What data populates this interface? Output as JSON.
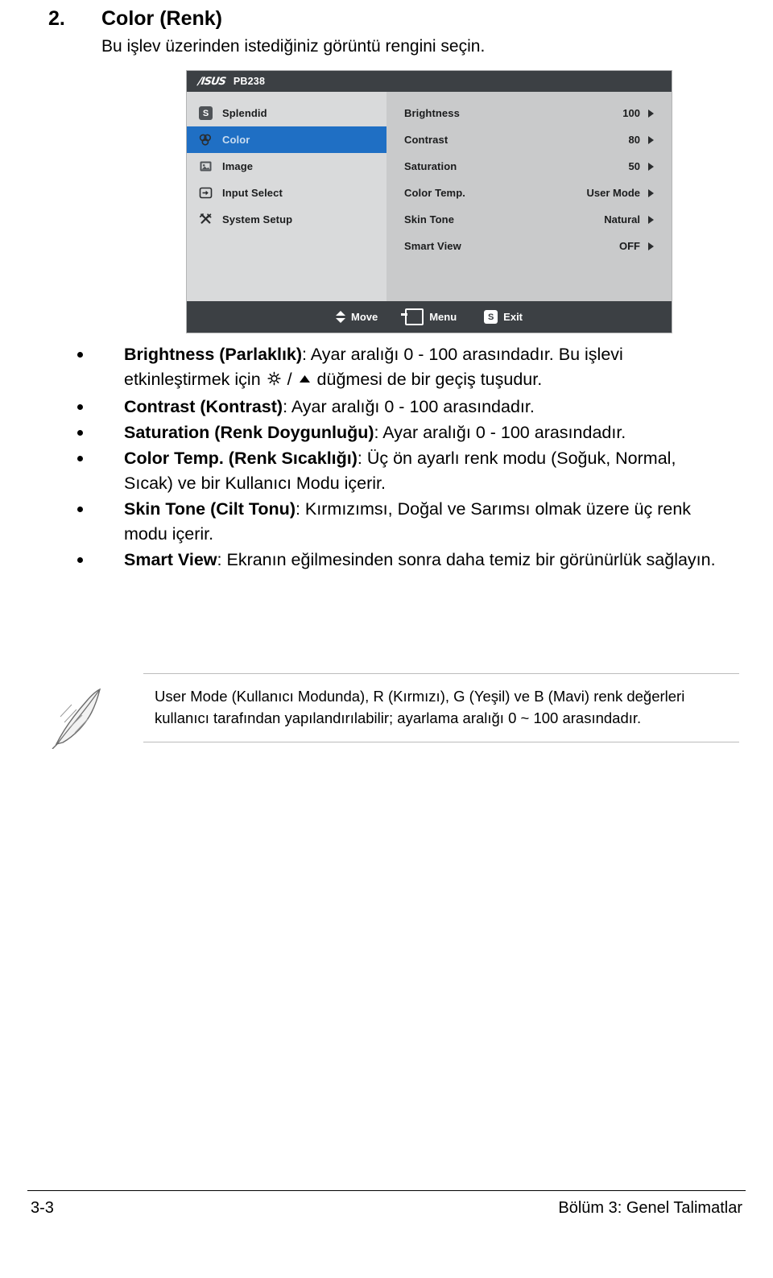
{
  "heading": {
    "number": "2.",
    "title": "Color (Renk)",
    "subtitle": "Bu işlev üzerinden istediğiniz görüntü rengini seçin."
  },
  "osd": {
    "brand": "/ISUS",
    "model": "PB238",
    "menu_items": [
      {
        "label": "Splendid",
        "icon": "splendid-icon",
        "selected": false
      },
      {
        "label": "Color",
        "icon": "color-icon",
        "selected": true
      },
      {
        "label": "Image",
        "icon": "image-icon",
        "selected": false
      },
      {
        "label": "Input Select",
        "icon": "input-select-icon",
        "selected": false
      },
      {
        "label": "System Setup",
        "icon": "system-setup-icon",
        "selected": false
      }
    ],
    "options": [
      {
        "name": "Brightness",
        "value": "100"
      },
      {
        "name": "Contrast",
        "value": "80"
      },
      {
        "name": "Saturation",
        "value": "50"
      },
      {
        "name": "Color Temp.",
        "value": "User Mode"
      },
      {
        "name": "Skin Tone",
        "value": "Natural"
      },
      {
        "name": "Smart View",
        "value": "OFF"
      }
    ],
    "footer": {
      "move": "Move",
      "menu": "Menu",
      "exit": "Exit",
      "exit_glyph": "S",
      "splendid_glyph": "S"
    }
  },
  "bullets": [
    {
      "bold": "Brightness (Parlaklık)",
      "text_a": ": Ayar aralığı 0 - 100 arasındadır. Bu işlevi etkinleştirmek için ",
      "text_b": " düğmesi de bir geçiş tuşudur.",
      "has_icons": true
    },
    {
      "bold": "Contrast (Kontrast)",
      "text_a": ": Ayar aralığı 0 - 100 arasındadır.",
      "text_b": "",
      "has_icons": false
    },
    {
      "bold": "Saturation (Renk Doygunluğu)",
      "text_a": ": Ayar aralığı 0 - 100 arasındadır.",
      "text_b": "",
      "has_icons": false
    },
    {
      "bold": "Color Temp. (Renk Sıcaklığı)",
      "text_a": ": Üç ön ayarlı renk modu (Soğuk, Normal, Sıcak) ve bir Kullanıcı Modu içerir.",
      "text_b": "",
      "has_icons": false
    },
    {
      "bold": "Skin Tone (Cilt Tonu)",
      "text_a": ": Kırmızımsı, Doğal ve Sarımsı olmak üzere üç renk modu içerir.",
      "text_b": "",
      "has_icons": false
    },
    {
      "bold": "Smart View",
      "text_a": ": Ekranın eğilmesinden sonra daha temiz bir görünürlük sağlayın.",
      "text_b": "",
      "has_icons": false
    }
  ],
  "note": {
    "text": "User Mode (Kullanıcı Modunda), R (Kırmızı), G (Yeşil) ve B (Mavi) renk değerleri kullanıcı tarafından yapılandırılabilir; ayarlama aralığı 0 ~ 100 arasındadır."
  },
  "footer": {
    "page": "3-3",
    "chapter": "Bölüm 3: Genel Talimatlar"
  }
}
